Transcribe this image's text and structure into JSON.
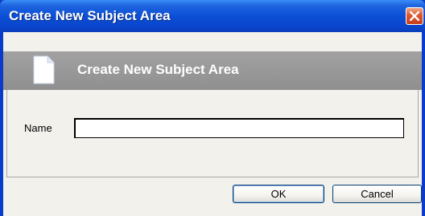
{
  "window": {
    "title": "Create New Subject Area",
    "close_icon": "close-icon"
  },
  "header": {
    "title": "Create New Subject Area",
    "icon": "document-icon"
  },
  "form": {
    "name_label": "Name",
    "name_value": "",
    "name_placeholder": ""
  },
  "buttons": {
    "ok_label": "OK",
    "cancel_label": "Cancel"
  },
  "colors": {
    "titlebar_blue": "#0b4fd6",
    "close_red": "#e2542c",
    "header_gray": "#999999",
    "dialog_bg": "#f2f1ec"
  }
}
